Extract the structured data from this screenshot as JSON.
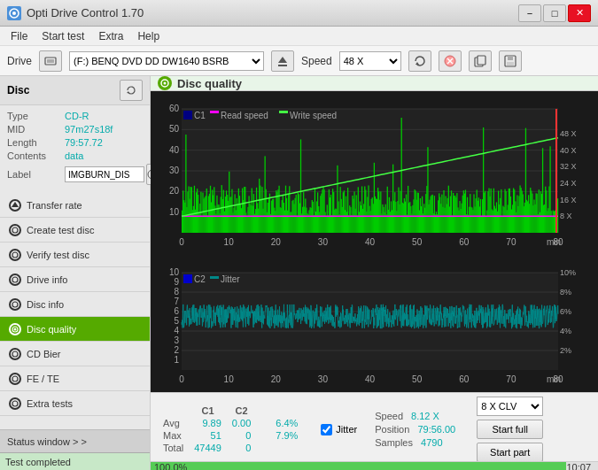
{
  "titlebar": {
    "title": "Opti Drive Control 1.70",
    "icon": "ODC",
    "min_btn": "−",
    "max_btn": "□",
    "close_btn": "✕"
  },
  "menubar": {
    "items": [
      "File",
      "Start test",
      "Extra",
      "Help"
    ]
  },
  "drivebar": {
    "drive_label": "Drive",
    "drive_value": "(F:)  BENQ DVD DD DW1640 BSRB",
    "speed_label": "Speed",
    "speed_value": "48 X"
  },
  "disc": {
    "title": "Disc",
    "type_label": "Type",
    "type_value": "CD-R",
    "mid_label": "MID",
    "mid_value": "97m27s18f",
    "length_label": "Length",
    "length_value": "79:57.72",
    "contents_label": "Contents",
    "contents_value": "data",
    "label_label": "Label",
    "label_value": "IMGBURN_DIS"
  },
  "nav": {
    "items": [
      {
        "id": "transfer-rate",
        "label": "Transfer rate",
        "active": false
      },
      {
        "id": "create-test-disc",
        "label": "Create test disc",
        "active": false
      },
      {
        "id": "verify-test-disc",
        "label": "Verify test disc",
        "active": false
      },
      {
        "id": "drive-info",
        "label": "Drive info",
        "active": false
      },
      {
        "id": "disc-info",
        "label": "Disc info",
        "active": false
      },
      {
        "id": "disc-quality",
        "label": "Disc quality",
        "active": true
      },
      {
        "id": "cd-bier",
        "label": "CD Bier",
        "active": false
      },
      {
        "id": "fe-te",
        "label": "FE / TE",
        "active": false
      },
      {
        "id": "extra-tests",
        "label": "Extra tests",
        "active": false
      }
    ],
    "status_window": "Status window > >"
  },
  "disc_quality": {
    "title": "Disc quality",
    "legend": {
      "c1_label": "C1",
      "read_label": "Read speed",
      "write_label": "Write speed"
    }
  },
  "stats": {
    "headers": [
      "",
      "C1",
      "C2"
    ],
    "avg_label": "Avg",
    "avg_c1": "9.89",
    "avg_c2": "0.00",
    "avg_jitter": "6.4%",
    "max_label": "Max",
    "max_c1": "51",
    "max_c2": "0",
    "max_jitter": "7.9%",
    "total_label": "Total",
    "total_c1": "47449",
    "total_c2": "0",
    "jitter_checked": true,
    "jitter_label": "Jitter",
    "speed_label": "Speed",
    "speed_value": "8.12 X",
    "position_label": "Position",
    "position_value": "79:56.00",
    "samples_label": "Samples",
    "samples_value": "4790",
    "clv_value": "8 X CLV",
    "start_full": "Start full",
    "start_part": "Start part"
  },
  "progress": {
    "value": 100,
    "text": "100.0%",
    "time": "10:07",
    "status": "Test completed"
  },
  "colors": {
    "green": "#55aa00",
    "cyan": "#00cccc",
    "dark_bg": "#1a1a1a",
    "chart_green": "#00cc00",
    "chart_cyan": "#00aaaa",
    "red_line": "#ff4444"
  }
}
